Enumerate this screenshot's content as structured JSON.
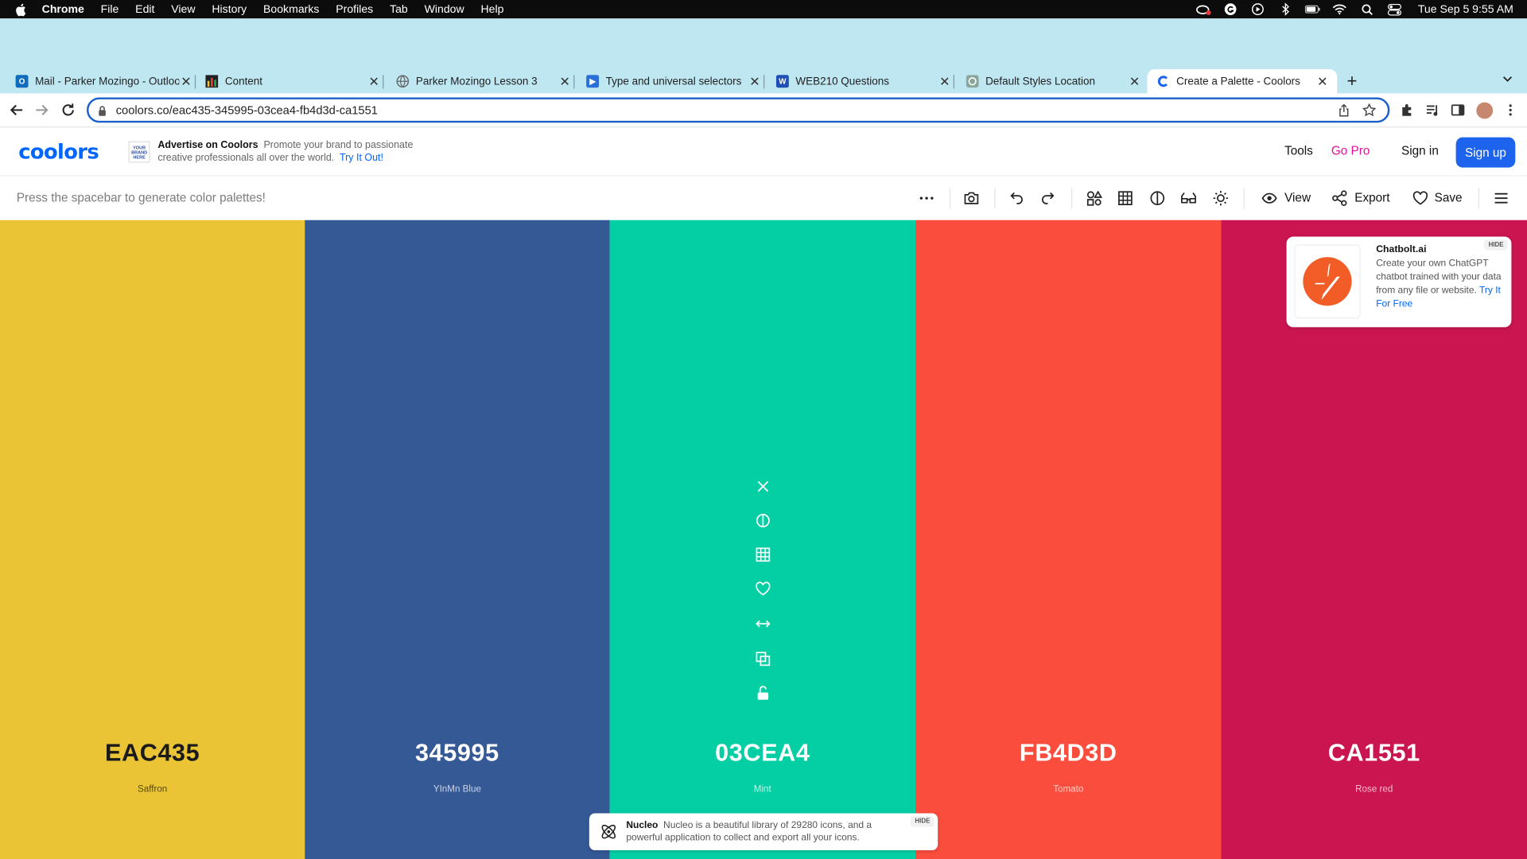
{
  "menubar": {
    "app": "Chrome",
    "items": [
      "File",
      "Edit",
      "View",
      "History",
      "Bookmarks",
      "Profiles",
      "Tab",
      "Window",
      "Help"
    ],
    "clock": "Tue Sep 5  9:55 AM"
  },
  "tabs": [
    {
      "title": "Mail - Parker Mozingo - Outlook",
      "favicon": "outlook-icon",
      "color": "#0f6cbd"
    },
    {
      "title": "Content",
      "favicon": "bar-chart-icon",
      "color": "#222222"
    },
    {
      "title": "Parker Mozingo Lesson 3",
      "favicon": "globe-icon",
      "color": "#777777"
    },
    {
      "title": "Type and universal selectors",
      "favicon": "video-icon",
      "color": "#2a6fd8"
    },
    {
      "title": "WEB210 Questions",
      "favicon": "word-icon",
      "color": "#1f4fb5"
    },
    {
      "title": "Default Styles Location",
      "favicon": "openai-icon",
      "color": "#8aa59a"
    },
    {
      "title": "Create a Palette - Coolors",
      "favicon": "coolors-icon",
      "color": "#1d63ed"
    }
  ],
  "address": {
    "url": "coolors.co/eac435-345995-03cea4-fb4d3d-ca1551"
  },
  "header": {
    "logo": "coolors",
    "ad_badge": "YOUR BRAND HERE",
    "ad_title": "Advertise on Coolors",
    "ad_body": "Promote your brand to passionate creative professionals all over the world.",
    "ad_link": "Try It Out!",
    "tools": "Tools",
    "gopro": "Go Pro",
    "signin": "Sign in",
    "signup": "Sign up"
  },
  "toolbar": {
    "hint": "Press the spacebar to generate color palettes!",
    "view": "View",
    "export": "Export",
    "save": "Save"
  },
  "palette": [
    {
      "hex": "EAC435",
      "name": "Saffron",
      "bg": "#EAC435",
      "fg": "#1a1a1a",
      "sub": "#5c4b10"
    },
    {
      "hex": "345995",
      "name": "YInMn Blue",
      "bg": "#345995",
      "fg": "#ffffff",
      "sub": "#c9d3e6"
    },
    {
      "hex": "03CEA4",
      "name": "Mint",
      "bg": "#03CEA4",
      "fg": "#ffffff",
      "sub": "#c9f4ea"
    },
    {
      "hex": "FB4D3D",
      "name": "Tomato",
      "bg": "#FB4D3D",
      "fg": "#ffffff",
      "sub": "#fed1cc"
    },
    {
      "hex": "CA1551",
      "name": "Rose red",
      "bg": "#CA1551",
      "fg": "#ffffff",
      "sub": "#f1c0d2"
    }
  ],
  "ad_card": {
    "title": "Chatbolt.ai",
    "body": "Create your own ChatGPT chatbot trained with your data from any file or website.",
    "link": "Try It For Free",
    "hide": "HIDE"
  },
  "nucleo": {
    "title": "Nucleo",
    "body": "Nucleo is a beautiful library of 29280 icons, and a powerful application to collect and export all your icons.",
    "hide": "HIDE"
  }
}
